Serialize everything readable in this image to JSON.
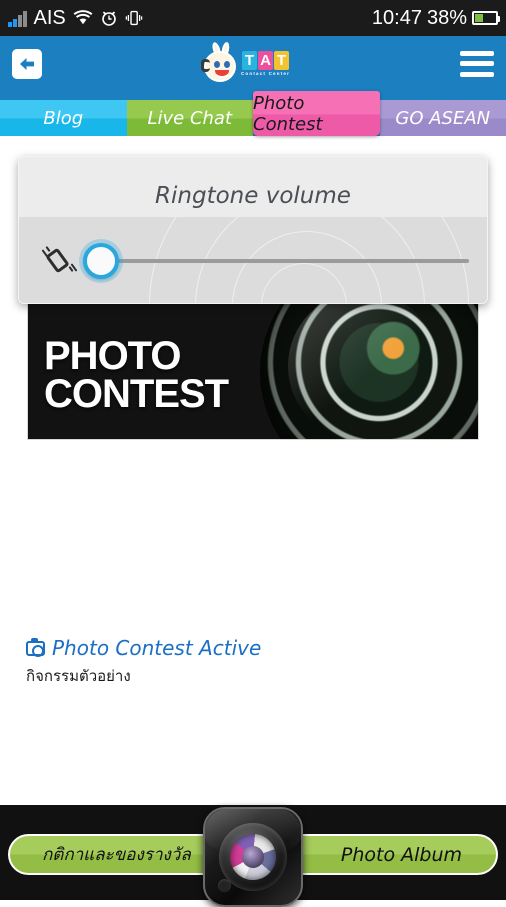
{
  "status_bar": {
    "carrier": "AIS",
    "time": "10:47",
    "battery_percent": "38%",
    "battery_level": 40,
    "icons": [
      "signal-bars-icon",
      "wifi-icon",
      "alarm-icon",
      "vibrate-icon",
      "battery-icon"
    ]
  },
  "header": {
    "back_icon": "back-arrow-icon",
    "menu_icon": "hamburger-menu-icon",
    "logo": {
      "letters": [
        "T",
        "A",
        "T"
      ],
      "subtitle": "Contact Center",
      "mascot": "mascot-headset-icon"
    }
  },
  "tabs": [
    {
      "label": "Blog",
      "color": "#3fc7f4",
      "active": false
    },
    {
      "label": "Live Chat",
      "color": "#96ca4f",
      "active": false
    },
    {
      "label": "Photo Contest",
      "color": "#f570b5",
      "active": true
    },
    {
      "label": "GO ASEAN",
      "color": "#a99ad4",
      "active": false
    }
  ],
  "banner": {
    "line1": "PHOTO",
    "line2": "CONTEST",
    "image": "camera-lens-photo"
  },
  "contest": {
    "title": "Photo Contest Active",
    "subtitle": "กิจกรรมตัวอย่าง",
    "icon": "camera-icon"
  },
  "volume_dialog": {
    "title": "Ringtone volume",
    "mode_icon": "vibrate-icon",
    "value": 0,
    "min": 0,
    "max": 100
  },
  "bottom_bar": {
    "left_label": "กติกาและของรางวัล",
    "right_label": "Photo Album",
    "camera_icon": "camera-button-icon"
  },
  "colors": {
    "header_blue": "#1b7fc0",
    "accent_blue": "#1a6fc4",
    "tab_active_pink": "#f570b5",
    "green_bar": "#a6cc5c",
    "slider_thumb_ring": "#29a8e0"
  }
}
